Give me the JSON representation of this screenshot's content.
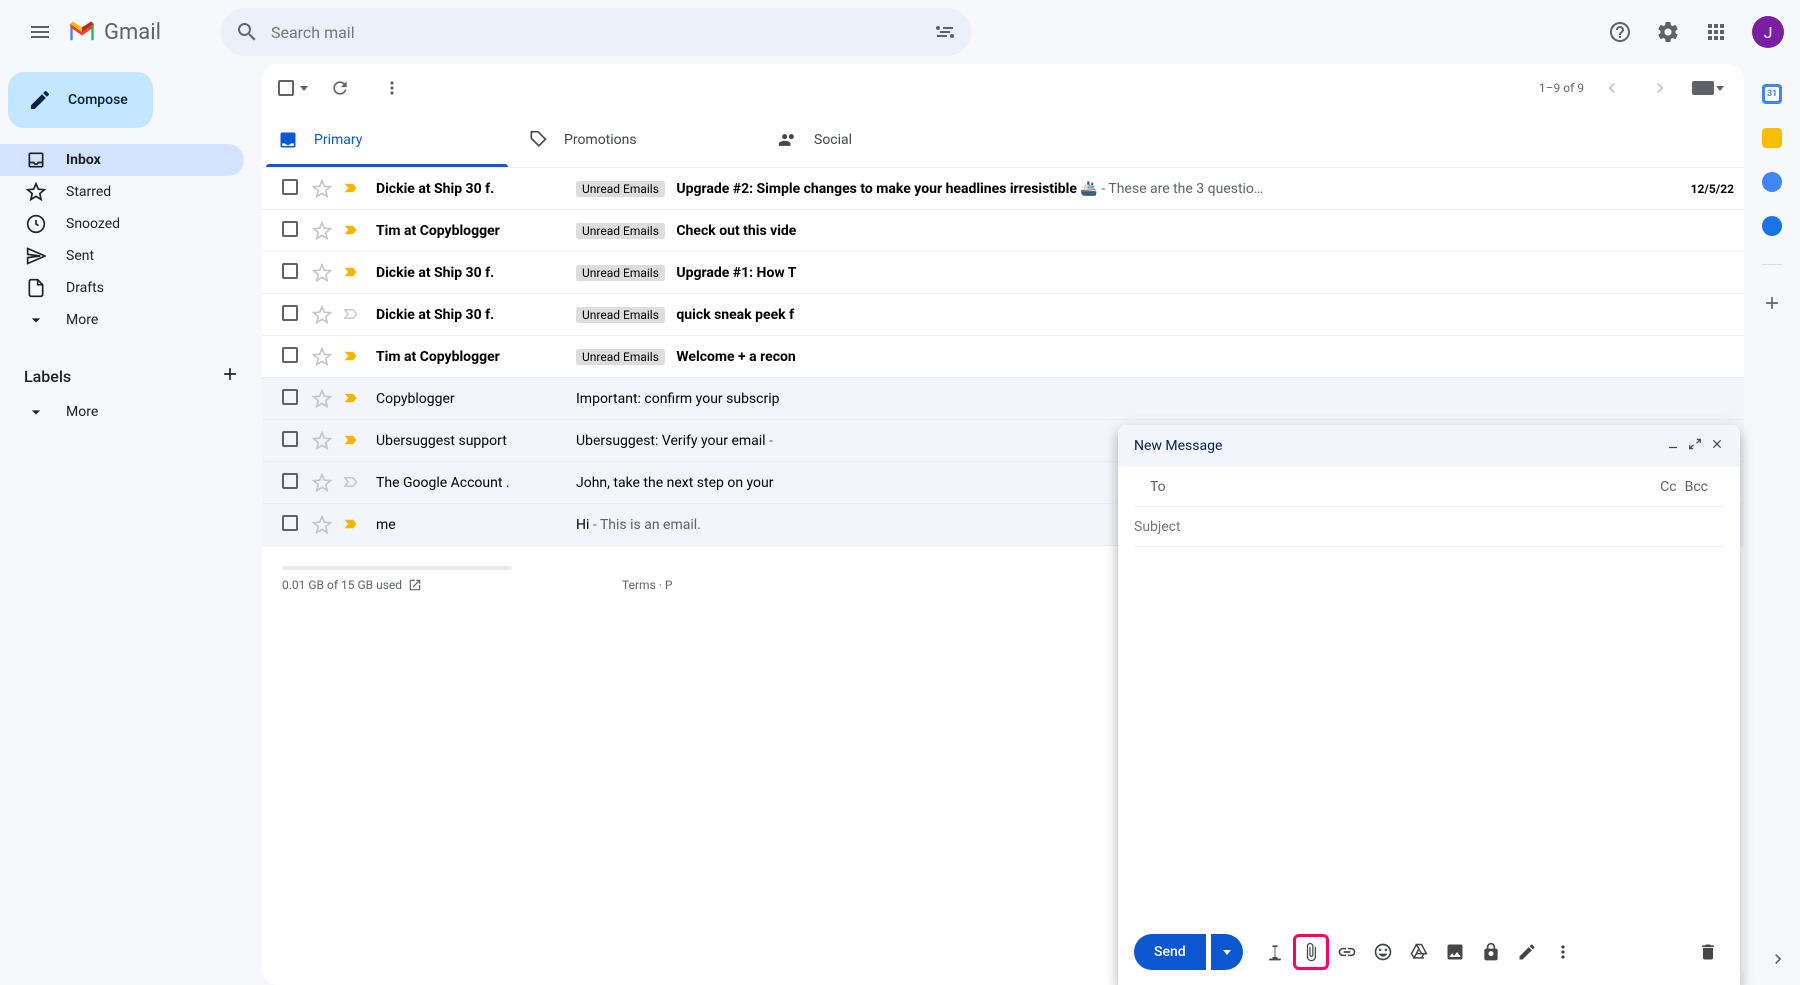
{
  "header": {
    "app_name": "Gmail",
    "search_placeholder": "Search mail",
    "avatar_letter": "J"
  },
  "sidebar": {
    "compose_label": "Compose",
    "items": [
      {
        "label": "Inbox",
        "icon": "inbox"
      },
      {
        "label": "Starred",
        "icon": "star"
      },
      {
        "label": "Snoozed",
        "icon": "clock"
      },
      {
        "label": "Sent",
        "icon": "send"
      },
      {
        "label": "Drafts",
        "icon": "draft"
      },
      {
        "label": "More",
        "icon": "expand"
      }
    ],
    "labels_header": "Labels",
    "more_label": "More"
  },
  "toolbar": {
    "page_info": "1–9 of 9"
  },
  "tabs": [
    {
      "label": "Primary"
    },
    {
      "label": "Promotions"
    },
    {
      "label": "Social"
    }
  ],
  "emails": [
    {
      "sender": "Dickie at Ship 30 f.",
      "label": "Unread Emails",
      "subject": "Upgrade #2: Simple changes to make your headlines irresistible 🚢",
      "preview": " - These are the 3 questio…",
      "date": "12/5/22",
      "unread": true,
      "important": true
    },
    {
      "sender": "Tim at Copyblogger",
      "label": "Unread Emails",
      "subject": "Check out this vide",
      "preview": "",
      "date": "",
      "unread": true,
      "important": true
    },
    {
      "sender": "Dickie at Ship 30 f.",
      "label": "Unread Emails",
      "subject": "Upgrade #1: How T",
      "preview": "",
      "date": "",
      "unread": true,
      "important": true
    },
    {
      "sender": "Dickie at Ship 30 f.",
      "label": "Unread Emails",
      "subject": "quick sneak peek f",
      "preview": "",
      "date": "",
      "unread": true,
      "important": false
    },
    {
      "sender": "Tim at Copyblogger",
      "label": "Unread Emails",
      "subject": "Welcome + a recon",
      "preview": "",
      "date": "",
      "unread": true,
      "important": true
    },
    {
      "sender": "Copyblogger",
      "label": "",
      "subject": "Important: confirm your subscrip",
      "preview": "",
      "date": "",
      "unread": false,
      "important": true
    },
    {
      "sender": "Ubersuggest support",
      "label": "",
      "subject": "Ubersuggest: Verify your email",
      "preview": " - ",
      "date": "",
      "unread": false,
      "important": true
    },
    {
      "sender": "The Google Account .",
      "label": "",
      "subject": "John, take the next step on your",
      "preview": "",
      "date": "",
      "unread": false,
      "important": false
    },
    {
      "sender": "me",
      "label": "",
      "subject": "Hi",
      "preview": " - This is an email.",
      "date": "",
      "unread": false,
      "important": true
    }
  ],
  "footer": {
    "storage_text": "0.01 GB of 15 GB used",
    "terms_text": "Terms · P"
  },
  "compose": {
    "title": "New Message",
    "to_label": "To",
    "cc_label": "Cc",
    "bcc_label": "Bcc",
    "subject_placeholder": "Subject",
    "send_label": "Send"
  }
}
